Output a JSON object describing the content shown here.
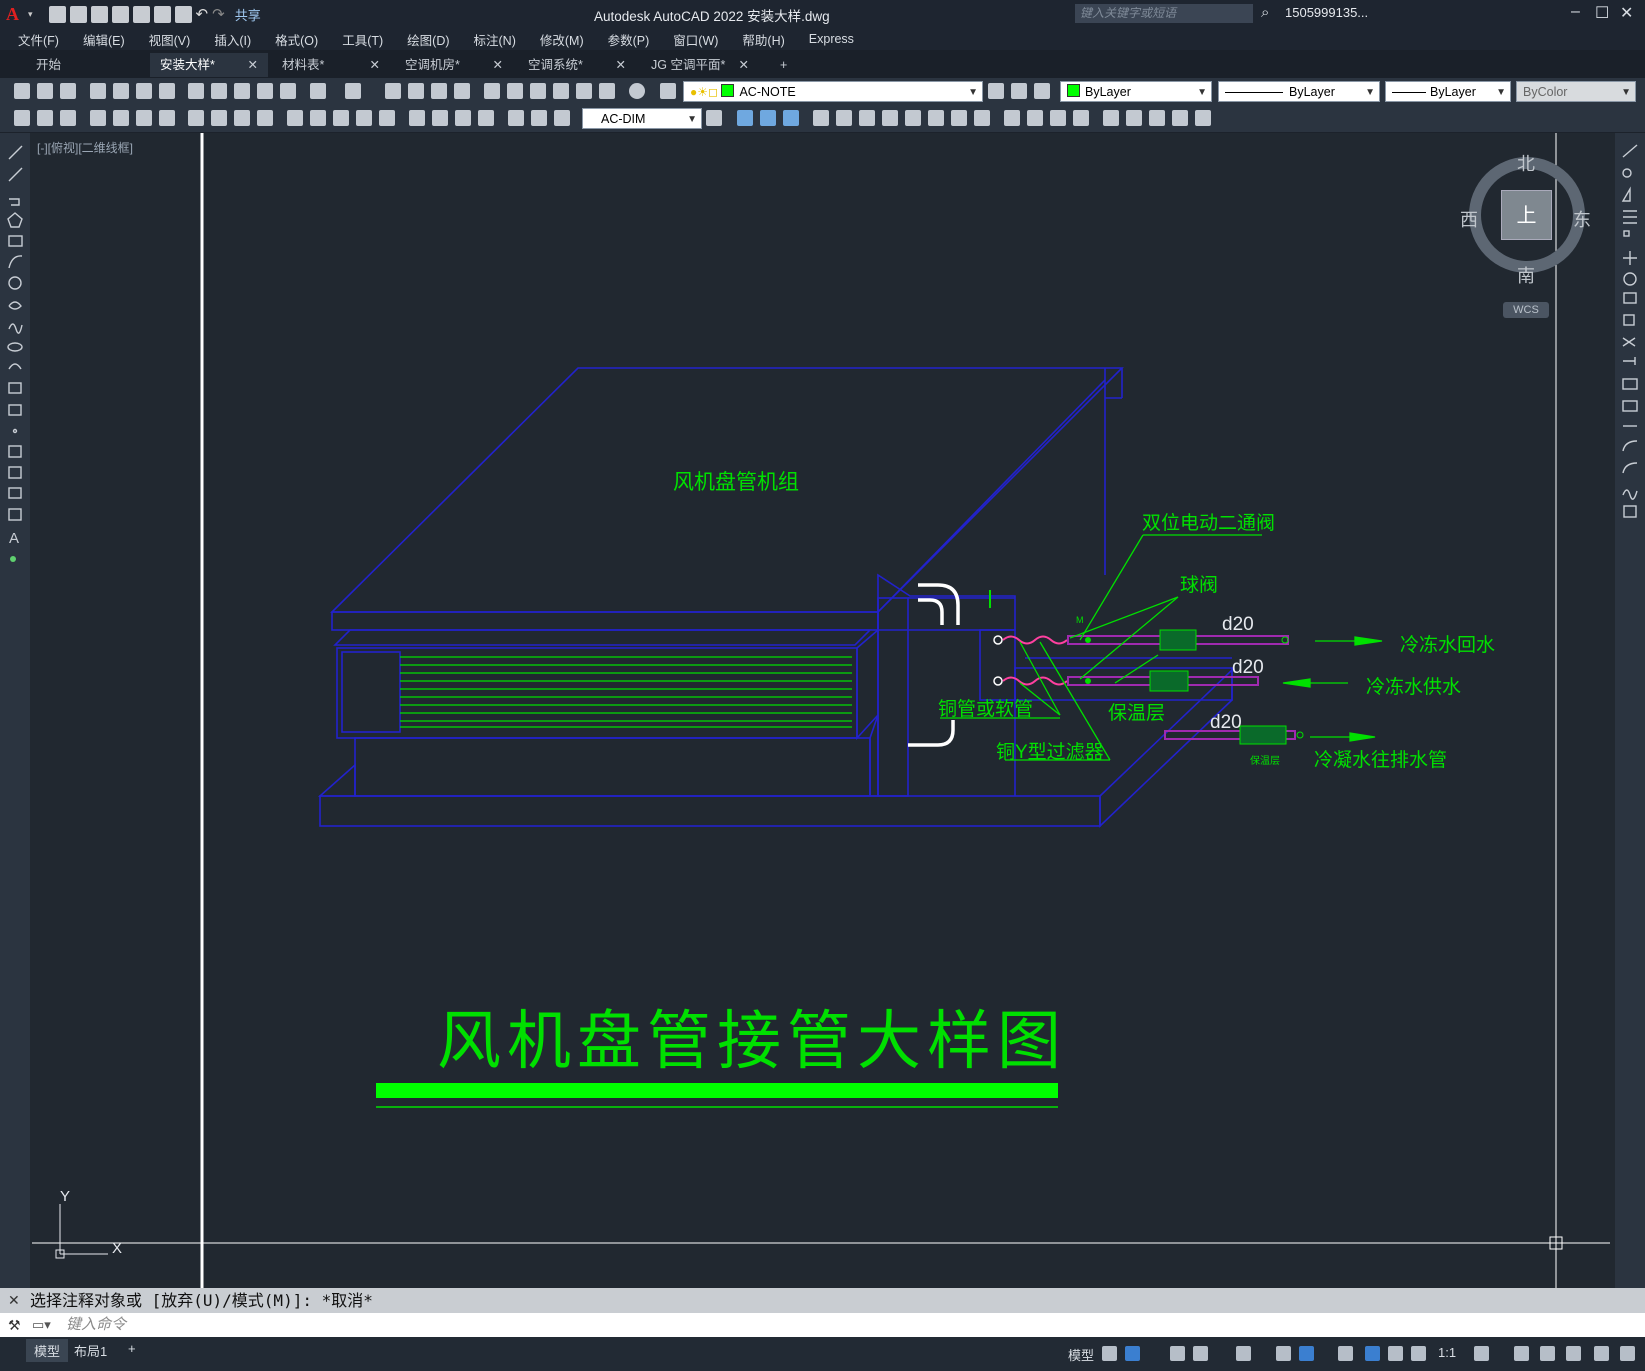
{
  "titlebar": {
    "app_logo": "A",
    "share": "共享",
    "title": "Autodesk AutoCAD 2022    安装大样.dwg",
    "search_placeholder": "键入关键字或短语",
    "user": "1505999135...",
    "minimize": "–",
    "maximize": "☐",
    "close": "✕"
  },
  "menu": [
    "文件(F)",
    "编辑(E)",
    "视图(V)",
    "插入(I)",
    "格式(O)",
    "工具(T)",
    "绘图(D)",
    "标注(N)",
    "修改(M)",
    "参数(P)",
    "窗口(W)",
    "帮助(H)",
    "Express"
  ],
  "tabs": [
    {
      "label": "开始",
      "close": ""
    },
    {
      "label": "安装大样*",
      "close": "✕"
    },
    {
      "label": "材料表*",
      "close": "✕"
    },
    {
      "label": "空调机房*",
      "close": "✕"
    },
    {
      "label": "空调系统*",
      "close": "✕"
    },
    {
      "label": "JG 空调平面*",
      "close": "✕"
    },
    {
      "label": "+",
      "close": ""
    }
  ],
  "toolbar": {
    "layer": "AC-NOTE",
    "color": "ByLayer",
    "linetype": "ByLayer",
    "lineweight": "ByLayer",
    "plotstyle": "ByColor",
    "dimstyle": "AC-DIM"
  },
  "viewport": {
    "label": "[-][俯视][二维线框]",
    "compass": {
      "n": "北",
      "s": "南",
      "e": "东",
      "w": "西",
      "face": "上"
    },
    "wcs": "WCS",
    "ucs_x": "X",
    "ucs_y": "Y"
  },
  "drawing": {
    "unit_label": "风机盘管机组",
    "valve_label": "双位电动二通阀",
    "ball_valve": "球阀",
    "d20_1": "d20",
    "d20_2": "d20",
    "d20_3": "d20",
    "return_water": "冷冻水回水",
    "supply_water": "冷冻水供水",
    "copper_pipe": "铜管或软管",
    "insulation": "保温层",
    "y_filter": "铜Y型过滤器",
    "insulation_small": "保温层",
    "condensate": "冷凝水往排水管",
    "valve_mark": "M",
    "main_title": "风机盘管接管大样图"
  },
  "command": {
    "history": "选择注释对象或 [放弃(U)/模式(M)]: *取消*",
    "prompt": "键入命令"
  },
  "status": {
    "layout_tabs": [
      "模型",
      "布局1",
      "+"
    ],
    "model": "模型",
    "scale": "1:1"
  }
}
